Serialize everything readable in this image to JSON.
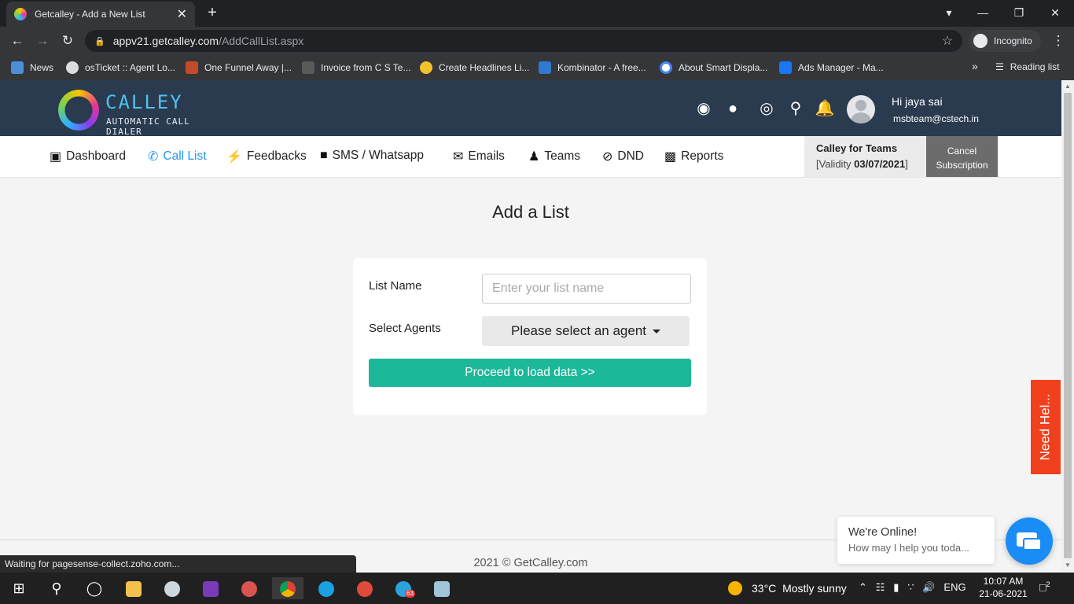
{
  "browser": {
    "tab_title": "Getcalley - Add a New List",
    "tab_close": "✕",
    "new_tab": "+",
    "url_host": "appv21.getcalley.com",
    "url_path": "/AddCallList.aspx",
    "incognito_label": "Incognito",
    "bookmarks": [
      "News",
      "osTicket :: Agent Lo...",
      "One Funnel Away |...",
      "Invoice from C S Te...",
      "Create Headlines Li...",
      "Kombinator - A free...",
      "About Smart Displa...",
      "Ads Manager - Ma..."
    ],
    "bookmark_overflow": "»",
    "reading_list": "Reading list",
    "status_text": "Waiting for pagesense-collect.zoho.com..."
  },
  "header": {
    "logo_name": "CALLEY",
    "logo_tagline": "AUTOMATIC CALL DIALER",
    "greeting": "Hi jaya sai",
    "email": "msbteam@cstech.in"
  },
  "nav": {
    "items": [
      {
        "label": "Dashboard",
        "icon": "dashboard-icon"
      },
      {
        "label": "Call List",
        "icon": "phone-icon"
      },
      {
        "label": "Feedbacks",
        "icon": "bolt-icon"
      },
      {
        "label": "SMS / Whatsapp",
        "icon": "message-icon"
      },
      {
        "label": "Emails",
        "icon": "envelope-icon"
      },
      {
        "label": "Teams",
        "icon": "users-icon"
      },
      {
        "label": "DND",
        "icon": "ban-icon"
      },
      {
        "label": "Reports",
        "icon": "gift-icon"
      }
    ],
    "active": "Call List",
    "plan_title": "Calley for Teams",
    "validity_prefix": "[Validity ",
    "validity_date": "03/07/2021",
    "validity_suffix": "]",
    "cancel_line1": "Cancel",
    "cancel_line2": "Subscription"
  },
  "main": {
    "title": "Add a List",
    "list_name_label": "List Name",
    "list_name_placeholder": "Enter your list name",
    "list_name_value": "",
    "select_agents_label": "Select Agents",
    "agent_select_value": "Please select an agent",
    "proceed_button": "Proceed to load data >>"
  },
  "footer": {
    "copyright": "2021 © GetCalley.com"
  },
  "widgets": {
    "need_help": "Need Hel...",
    "chat_title": "We're Online!",
    "chat_subtitle": "How may I help you toda..."
  },
  "taskbar": {
    "weather_temp": "33°C",
    "weather_text": "Mostly sunny",
    "language": "ENG",
    "time": "10:07 AM",
    "date": "21-06-2021",
    "notification_count": "2",
    "telegram_badge": "63"
  },
  "colors": {
    "header_bg": "#2a3a4f",
    "accent_blue": "#2196f3",
    "proceed_green": "#1bb89a",
    "need_help_red": "#f0401d",
    "chat_blue": "#1a8cf5"
  }
}
